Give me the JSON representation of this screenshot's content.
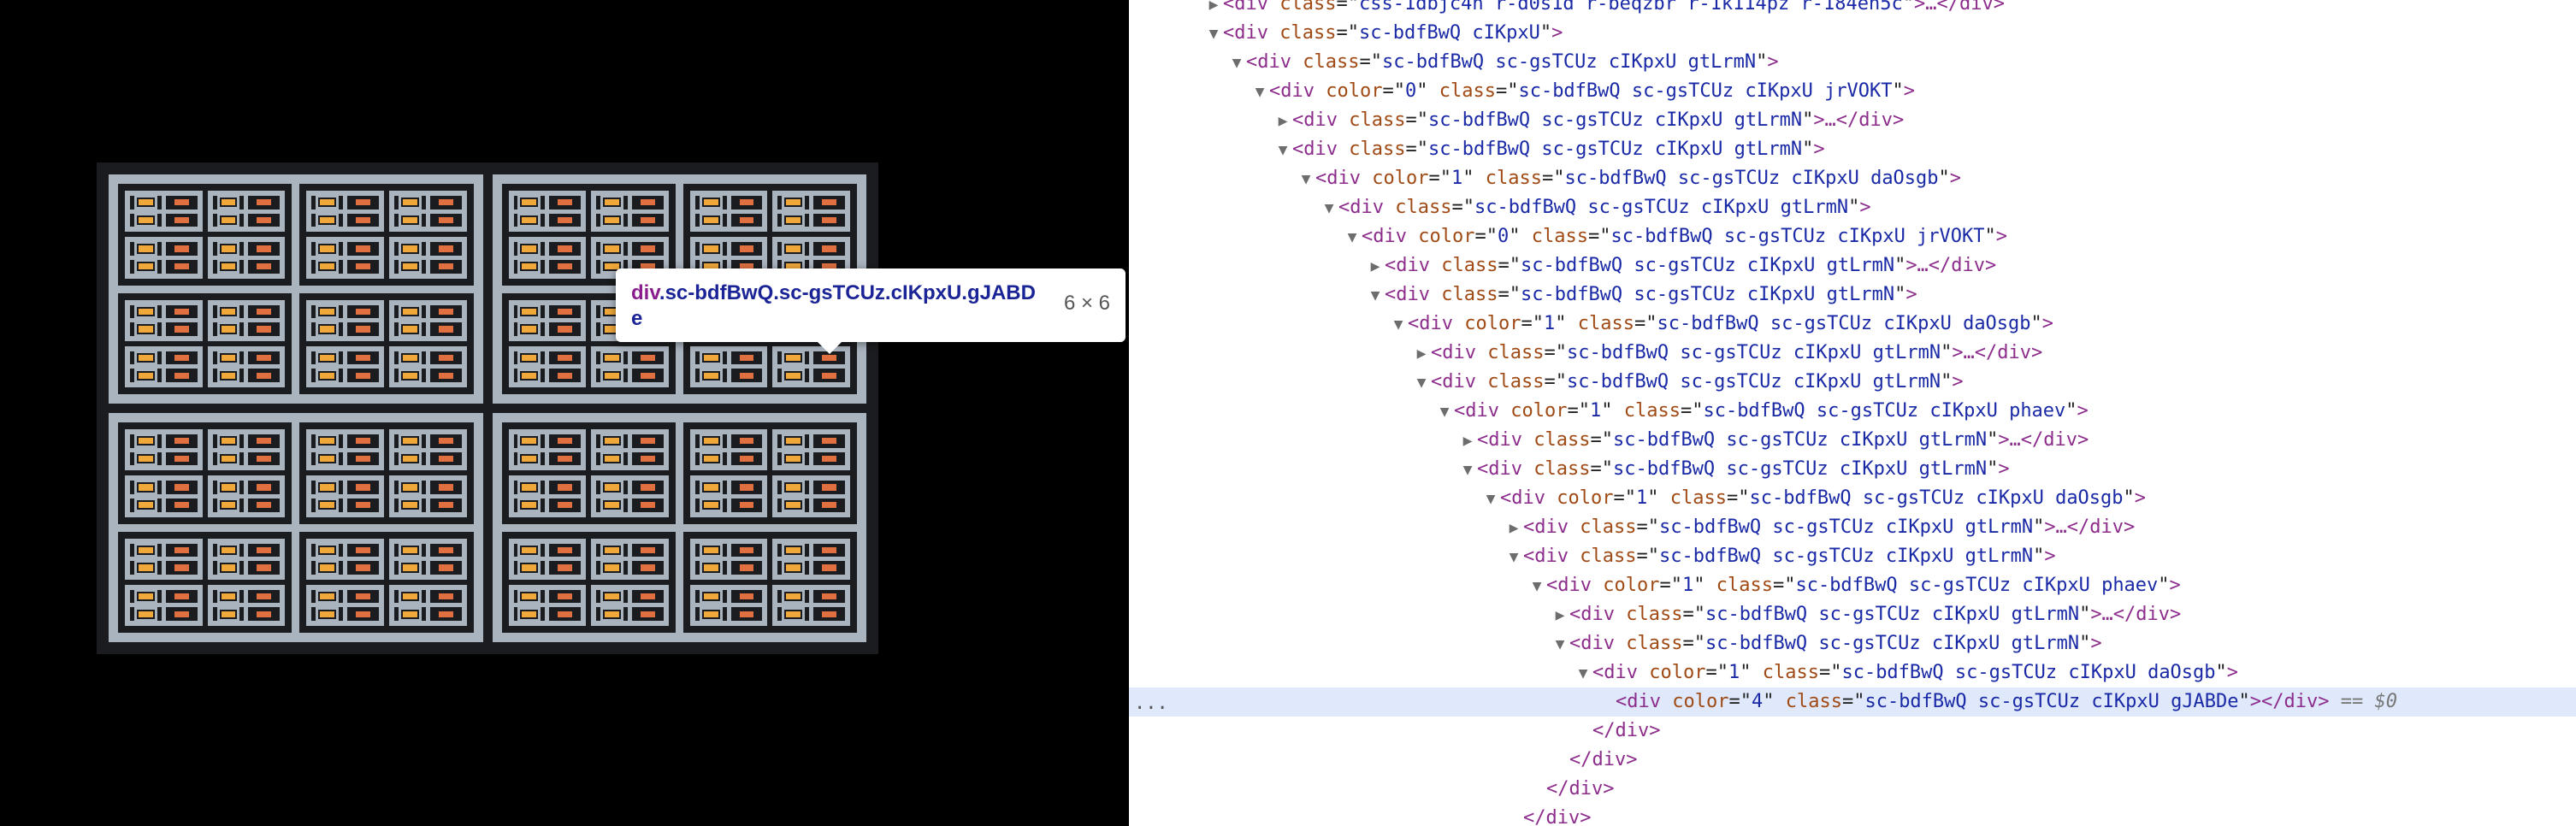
{
  "preview": {
    "colors": {
      "dark": "#1b1c1f",
      "light": "#aab4bf",
      "orange": "#f0a83a",
      "red": "#e07040",
      "pink": "#c98bbf"
    },
    "tooltip": {
      "tag": "div",
      "classes": ".sc-bdfBwQ.sc-gsTCUz.cIKpxU.gJABDe",
      "dimensions": "6 × 6"
    }
  },
  "devtools": {
    "ellipsis": "...",
    "lines": [
      {
        "indent": 0,
        "twisty": "right",
        "tag": "div",
        "attrs": [
          {
            "n": "class",
            "v": "css-1dbjc4n r-d0s1d r-beqzbr r-1k114pz r-184en5c"
          }
        ],
        "tail": ">…</div>"
      },
      {
        "indent": 0,
        "twisty": "down",
        "tag": "div",
        "attrs": [
          {
            "n": "class",
            "v": "sc-bdfBwQ cIKpxU"
          }
        ],
        "tail": ">"
      },
      {
        "indent": 1,
        "twisty": "down",
        "tag": "div",
        "attrs": [
          {
            "n": "class",
            "v": "sc-bdfBwQ sc-gsTCUz cIKpxU gtLrmN"
          }
        ],
        "tail": ">"
      },
      {
        "indent": 2,
        "twisty": "down",
        "tag": "div",
        "attrs": [
          {
            "n": "color",
            "v": "0"
          },
          {
            "n": "class",
            "v": "sc-bdfBwQ sc-gsTCUz cIKpxU jrVOKT"
          }
        ],
        "tail": ">"
      },
      {
        "indent": 3,
        "twisty": "right",
        "tag": "div",
        "attrs": [
          {
            "n": "class",
            "v": "sc-bdfBwQ sc-gsTCUz cIKpxU gtLrmN"
          }
        ],
        "tail": ">…</div>"
      },
      {
        "indent": 3,
        "twisty": "down",
        "tag": "div",
        "attrs": [
          {
            "n": "class",
            "v": "sc-bdfBwQ sc-gsTCUz cIKpxU gtLrmN"
          }
        ],
        "tail": ">"
      },
      {
        "indent": 4,
        "twisty": "down",
        "tag": "div",
        "attrs": [
          {
            "n": "color",
            "v": "1"
          },
          {
            "n": "class",
            "v": "sc-bdfBwQ sc-gsTCUz cIKpxU daOsgb"
          }
        ],
        "tail": ">"
      },
      {
        "indent": 5,
        "twisty": "down",
        "tag": "div",
        "attrs": [
          {
            "n": "class",
            "v": "sc-bdfBwQ sc-gsTCUz cIKpxU gtLrmN"
          }
        ],
        "tail": ">"
      },
      {
        "indent": 6,
        "twisty": "down",
        "tag": "div",
        "attrs": [
          {
            "n": "color",
            "v": "0"
          },
          {
            "n": "class",
            "v": "sc-bdfBwQ sc-gsTCUz cIKpxU jrVOKT"
          }
        ],
        "tail": ">"
      },
      {
        "indent": 7,
        "twisty": "right",
        "tag": "div",
        "attrs": [
          {
            "n": "class",
            "v": "sc-bdfBwQ sc-gsTCUz cIKpxU gtLrmN"
          }
        ],
        "tail": ">…</div>"
      },
      {
        "indent": 7,
        "twisty": "down",
        "tag": "div",
        "attrs": [
          {
            "n": "class",
            "v": "sc-bdfBwQ sc-gsTCUz cIKpxU gtLrmN"
          }
        ],
        "tail": ">"
      },
      {
        "indent": 8,
        "twisty": "down",
        "tag": "div",
        "attrs": [
          {
            "n": "color",
            "v": "1"
          },
          {
            "n": "class",
            "v": "sc-bdfBwQ sc-gsTCUz cIKpxU daOsgb"
          }
        ],
        "tail": ">"
      },
      {
        "indent": 9,
        "twisty": "right",
        "tag": "div",
        "attrs": [
          {
            "n": "class",
            "v": "sc-bdfBwQ sc-gsTCUz cIKpxU gtLrmN"
          }
        ],
        "tail": ">…</div>"
      },
      {
        "indent": 9,
        "twisty": "down",
        "tag": "div",
        "attrs": [
          {
            "n": "class",
            "v": "sc-bdfBwQ sc-gsTCUz cIKpxU gtLrmN"
          }
        ],
        "tail": ">"
      },
      {
        "indent": 10,
        "twisty": "down",
        "tag": "div",
        "attrs": [
          {
            "n": "color",
            "v": "1"
          },
          {
            "n": "class",
            "v": "sc-bdfBwQ sc-gsTCUz cIKpxU phaev"
          }
        ],
        "tail": ">"
      },
      {
        "indent": 11,
        "twisty": "right",
        "tag": "div",
        "attrs": [
          {
            "n": "class",
            "v": "sc-bdfBwQ sc-gsTCUz cIKpxU gtLrmN"
          }
        ],
        "tail": ">…</div>"
      },
      {
        "indent": 11,
        "twisty": "down",
        "tag": "div",
        "attrs": [
          {
            "n": "class",
            "v": "sc-bdfBwQ sc-gsTCUz cIKpxU gtLrmN"
          }
        ],
        "tail": ">"
      },
      {
        "indent": 12,
        "twisty": "down",
        "tag": "div",
        "attrs": [
          {
            "n": "color",
            "v": "1"
          },
          {
            "n": "class",
            "v": "sc-bdfBwQ sc-gsTCUz cIKpxU daOsgb"
          }
        ],
        "tail": ">"
      },
      {
        "indent": 13,
        "twisty": "right",
        "tag": "div",
        "attrs": [
          {
            "n": "class",
            "v": "sc-bdfBwQ sc-gsTCUz cIKpxU gtLrmN"
          }
        ],
        "tail": ">…</div>"
      },
      {
        "indent": 13,
        "twisty": "down",
        "tag": "div",
        "attrs": [
          {
            "n": "class",
            "v": "sc-bdfBwQ sc-gsTCUz cIKpxU gtLrmN"
          }
        ],
        "tail": ">"
      },
      {
        "indent": 14,
        "twisty": "down",
        "tag": "div",
        "attrs": [
          {
            "n": "color",
            "v": "1"
          },
          {
            "n": "class",
            "v": "sc-bdfBwQ sc-gsTCUz cIKpxU phaev"
          }
        ],
        "tail": ">"
      },
      {
        "indent": 15,
        "twisty": "right",
        "tag": "div",
        "attrs": [
          {
            "n": "class",
            "v": "sc-bdfBwQ sc-gsTCUz cIKpxU gtLrmN"
          }
        ],
        "tail": ">…</div>"
      },
      {
        "indent": 15,
        "twisty": "down",
        "tag": "div",
        "attrs": [
          {
            "n": "class",
            "v": "sc-bdfBwQ sc-gsTCUz cIKpxU gtLrmN"
          }
        ],
        "tail": ">"
      },
      {
        "indent": 16,
        "twisty": "down",
        "tag": "div",
        "attrs": [
          {
            "n": "color",
            "v": "1"
          },
          {
            "n": "class",
            "v": "sc-bdfBwQ sc-gsTCUz cIKpxU daOsgb"
          }
        ],
        "tail": ">"
      },
      {
        "indent": 17,
        "twisty": "none",
        "tag": "div",
        "attrs": [
          {
            "n": "color",
            "v": "4"
          },
          {
            "n": "class",
            "v": "sc-bdfBwQ sc-gsTCUz cIKpxU gJABDe"
          }
        ],
        "tail": "></div>",
        "selected": true,
        "suffix": " == $0"
      },
      {
        "indent": 16,
        "twisty": "none",
        "close": "</div>"
      },
      {
        "indent": 15,
        "twisty": "none",
        "close": "</div>"
      },
      {
        "indent": 14,
        "twisty": "none",
        "close": "</div>"
      },
      {
        "indent": 13,
        "twisty": "none",
        "close": "</div>"
      }
    ]
  }
}
